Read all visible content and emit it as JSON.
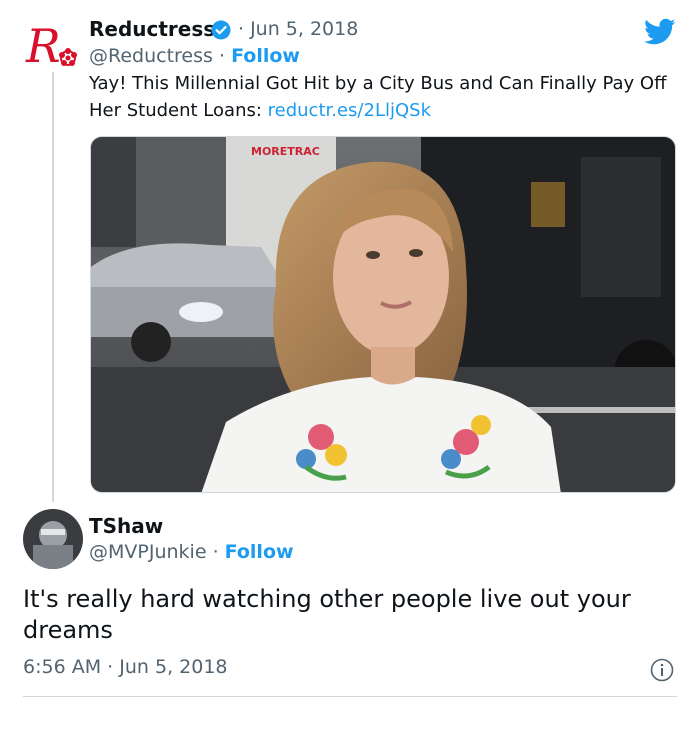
{
  "first_tweet": {
    "author_name": "Reductress",
    "date": "· Jun 5, 2018",
    "handle": "@Reductress",
    "follow_label": "Follow",
    "text": "Yay! This Millennial Got Hit by a City Bus and Can Finally Pay Off Her Student Loans: ",
    "link": "reductr.es/2LljQSk",
    "logo_icon": "reductress-logo-icon",
    "verified_icon": "verified-badge-icon",
    "brand_icon": "twitter-bird-icon"
  },
  "reply_tweet": {
    "author_name": "TShaw",
    "handle": "@MVPJunkie",
    "follow_label": "Follow",
    "text": "It's really hard watching other people live out your dreams",
    "time": "6:56 AM",
    "date": "Jun 5, 2018",
    "info_icon": "info-icon"
  },
  "colors": {
    "link": "#1d9bf0",
    "logo_red": "#d9102b",
    "muted": "#536471"
  }
}
